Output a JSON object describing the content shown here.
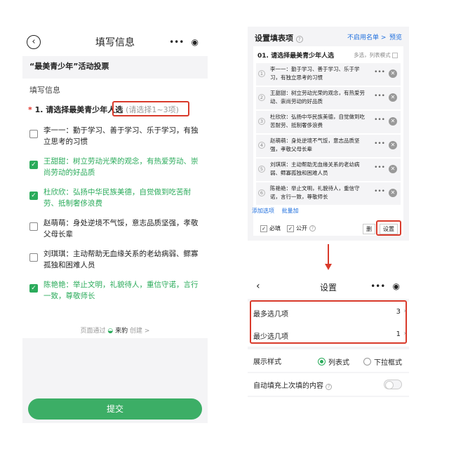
{
  "left": {
    "header_title": "填写信息",
    "back_icon": "‹",
    "subtitle": "“最美青少年”活动投票",
    "section": "填写信息",
    "question_prefix": "*",
    "question": "1. 请选择最美青少年人选",
    "question_hint": "(请选择1~3项)",
    "options": [
      {
        "text": "李一一：勤于学习、善于学习、乐于学习，有独立思考的习惯",
        "checked": false
      },
      {
        "text": "王甜甜：树立劳动光荣的观念，有热爱劳动、崇尚劳动的好品质",
        "checked": true
      },
      {
        "text": "杜欣欣：弘扬中华民族美德，自觉做到吃苦耐劳、抵制奢侈浪费",
        "checked": true
      },
      {
        "text": "赵萌萌：身处逆境不气馁，意志品质坚强，孝敬父母长辈",
        "checked": false
      },
      {
        "text": "刘琪琪：主动帮助无血缘关系的老幼病弱、鳏寡孤独和困难人员",
        "checked": false
      },
      {
        "text": "陈艳艳：举止文明，礼貌待人，重信守诺，言行一致，尊敬师长",
        "checked": true
      }
    ],
    "footer_text": "页面通过",
    "footer_brand": "来豹",
    "footer_suffix": "创建 >",
    "submit": "提交",
    "colors": {
      "accent": "#2bab5b",
      "submit": "#3cae66",
      "highlight": "#d93a2b"
    }
  },
  "right_top": {
    "title": "设置填表项",
    "link_disable": "不启用名单 >",
    "link_preview": "预览",
    "question": "01.   请选择最美青少年人选",
    "mode": "多选，列表模式",
    "options": [
      {
        "num": "1",
        "text": "李一一：勤于学习、善于学习、乐于学习，有独立思考的习惯"
      },
      {
        "num": "2",
        "text": "王甜甜：树立劳动光荣的观念，有热爱劳动、崇尚劳动的好品质"
      },
      {
        "num": "3",
        "text": "杜欣欣：弘扬中华民族美德，自觉做到吃苦耐劳、抵制奢侈浪费"
      },
      {
        "num": "4",
        "text": "赵萌萌：身处逆境不气馁，意志品质坚强，孝敬父母长辈"
      },
      {
        "num": "5",
        "text": "刘琪琪：主动帮助无血缘关系的老幼病弱、鳏寡孤独和困难人员"
      },
      {
        "num": "6",
        "text": "陈艳艳：举止文明，礼貌待人，重信守诺，言行一致，尊敬师长"
      }
    ],
    "add_option": "添加选项",
    "batch_add": "批量加",
    "required": "必填",
    "public": "公开",
    "delete": "删",
    "settings": "设置"
  },
  "right_bottom": {
    "title": "设置",
    "max_label": "最多选几项",
    "max_value": "3",
    "min_label": "最少选几项",
    "min_value": "1",
    "display_label": "展示样式",
    "display_list": "列表式",
    "display_dropdown": "下拉框式",
    "autofill_label": "自动填充上次填的内容"
  }
}
